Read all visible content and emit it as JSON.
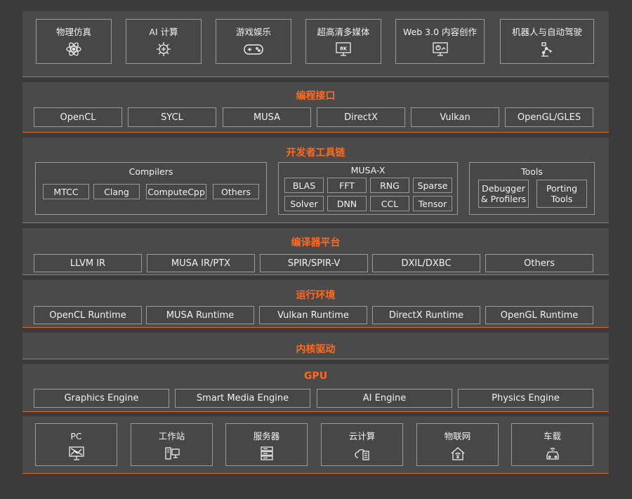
{
  "applications": [
    {
      "label": "物理仿真",
      "icon": "atom-icon"
    },
    {
      "label": "AI 计算",
      "icon": "ai-chip-icon"
    },
    {
      "label": "游戏娱乐",
      "icon": "gamepad-icon"
    },
    {
      "label": "超高清多媒体",
      "icon": "8k-display-icon"
    },
    {
      "label": "Web 3.0 内容创作",
      "icon": "monitor-chart-icon"
    },
    {
      "label": "机器人与自动驾驶",
      "icon": "robot-arm-icon"
    }
  ],
  "programming_interfaces": {
    "title": "编程接口",
    "items": [
      "OpenCL",
      "SYCL",
      "MUSA",
      "DirectX",
      "Vulkan",
      "OpenGL/GLES"
    ]
  },
  "developer_toolchain": {
    "title": "开发者工具链",
    "compilers": {
      "title": "Compilers",
      "items": [
        "MTCC",
        "Clang",
        "ComputeCpp",
        "Others"
      ]
    },
    "musa_x": {
      "title": "MUSA-X",
      "items": [
        "BLAS",
        "FFT",
        "RNG",
        "Sparse",
        "Solver",
        "DNN",
        "CCL",
        "Tensor"
      ]
    },
    "tools": {
      "title": "Tools",
      "items": [
        "Debugger & Profilers",
        "Porting Tools"
      ]
    }
  },
  "compiler_platform": {
    "title": "编译器平台",
    "items": [
      "LLVM IR",
      "MUSA IR/PTX",
      "SPIR/SPIR-V",
      "DXIL/DXBC",
      "Others"
    ]
  },
  "runtime": {
    "title": "运行环境",
    "items": [
      "OpenCL Runtime",
      "MUSA Runtime",
      "Vulkan Runtime",
      "DirectX Runtime",
      "OpenGL Runtime"
    ]
  },
  "kernel_driver": {
    "title": "内核驱动"
  },
  "gpu": {
    "title": "GPU",
    "items": [
      "Graphics Engine",
      "Smart Media Engine",
      "AI Engine",
      "Physics Engine"
    ]
  },
  "devices": [
    {
      "label": "PC",
      "icon": "pc-monitor-icon"
    },
    {
      "label": "工作站",
      "icon": "workstation-icon"
    },
    {
      "label": "服务器",
      "icon": "server-icon"
    },
    {
      "label": "云计算",
      "icon": "cloud-computing-icon"
    },
    {
      "label": "物联网",
      "icon": "iot-house-icon"
    },
    {
      "label": "车载",
      "icon": "car-icon"
    }
  ],
  "colors": {
    "accent": "#ff6a1f",
    "band": "#4a4a4a",
    "border": "#9a9a9a",
    "background": "#3b3b3b"
  }
}
